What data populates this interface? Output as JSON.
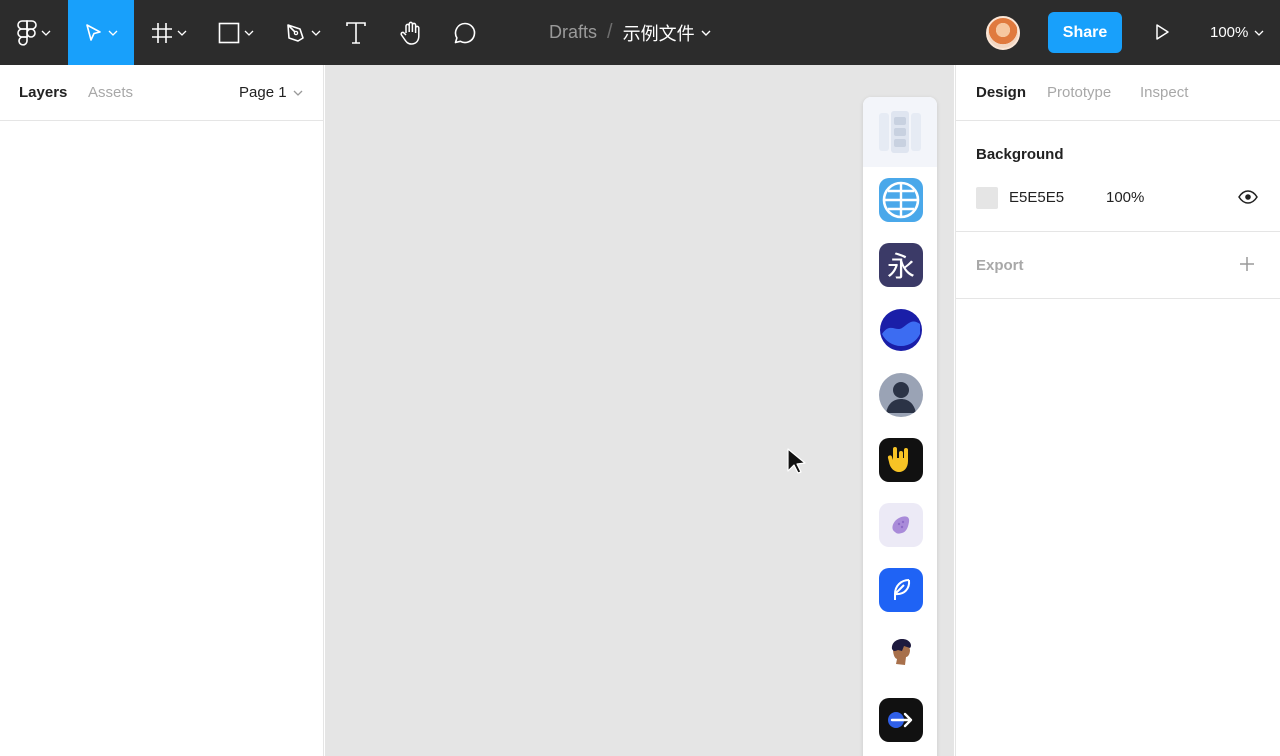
{
  "toolbar": {
    "breadcrumb_root": "Drafts",
    "separator": "/",
    "file_name": "示例文件",
    "share_label": "Share",
    "zoom_level": "100%",
    "active_tool": "move",
    "accent_color": "#18a0fb",
    "tools": [
      "figma-menu-icon",
      "move-icon",
      "frame-icon",
      "rectangle-icon",
      "pen-icon",
      "text-icon",
      "hand-icon",
      "comment-icon"
    ]
  },
  "left_panel": {
    "tab_layers": "Layers",
    "tab_assets": "Assets",
    "page_selector": "Page 1"
  },
  "canvas": {
    "background_color": "#e5e5e5",
    "plugins": [
      "layout-grid-plugin-icon",
      "globe-plugin-icon",
      "yong-character-plugin-icon",
      "wave-plugin-icon",
      "avatar-plugin-icon",
      "rock-hand-plugin-icon",
      "blob-plugin-icon",
      "feather-plugin-icon",
      "person-portrait-plugin-icon",
      "arrow-plugin-icon"
    ],
    "yong_character": "永"
  },
  "right_panel": {
    "tab_design": "Design",
    "tab_prototype": "Prototype",
    "tab_inspect": "Inspect",
    "background": {
      "title": "Background",
      "hex": "E5E5E5",
      "opacity": "100%",
      "swatch_color": "#e5e5e5"
    },
    "export": {
      "title": "Export"
    }
  }
}
